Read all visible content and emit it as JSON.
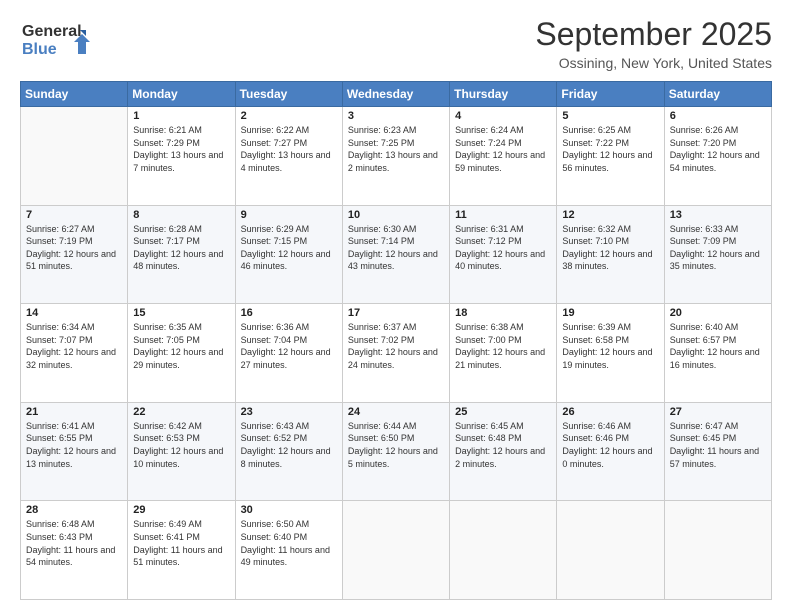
{
  "header": {
    "logo_general": "General",
    "logo_blue": "Blue",
    "month": "September 2025",
    "location": "Ossining, New York, United States"
  },
  "days_of_week": [
    "Sunday",
    "Monday",
    "Tuesday",
    "Wednesday",
    "Thursday",
    "Friday",
    "Saturday"
  ],
  "weeks": [
    [
      {
        "day": "",
        "sunrise": "",
        "sunset": "",
        "daylight": ""
      },
      {
        "day": "1",
        "sunrise": "Sunrise: 6:21 AM",
        "sunset": "Sunset: 7:29 PM",
        "daylight": "Daylight: 13 hours and 7 minutes."
      },
      {
        "day": "2",
        "sunrise": "Sunrise: 6:22 AM",
        "sunset": "Sunset: 7:27 PM",
        "daylight": "Daylight: 13 hours and 4 minutes."
      },
      {
        "day": "3",
        "sunrise": "Sunrise: 6:23 AM",
        "sunset": "Sunset: 7:25 PM",
        "daylight": "Daylight: 13 hours and 2 minutes."
      },
      {
        "day": "4",
        "sunrise": "Sunrise: 6:24 AM",
        "sunset": "Sunset: 7:24 PM",
        "daylight": "Daylight: 12 hours and 59 minutes."
      },
      {
        "day": "5",
        "sunrise": "Sunrise: 6:25 AM",
        "sunset": "Sunset: 7:22 PM",
        "daylight": "Daylight: 12 hours and 56 minutes."
      },
      {
        "day": "6",
        "sunrise": "Sunrise: 6:26 AM",
        "sunset": "Sunset: 7:20 PM",
        "daylight": "Daylight: 12 hours and 54 minutes."
      }
    ],
    [
      {
        "day": "7",
        "sunrise": "Sunrise: 6:27 AM",
        "sunset": "Sunset: 7:19 PM",
        "daylight": "Daylight: 12 hours and 51 minutes."
      },
      {
        "day": "8",
        "sunrise": "Sunrise: 6:28 AM",
        "sunset": "Sunset: 7:17 PM",
        "daylight": "Daylight: 12 hours and 48 minutes."
      },
      {
        "day": "9",
        "sunrise": "Sunrise: 6:29 AM",
        "sunset": "Sunset: 7:15 PM",
        "daylight": "Daylight: 12 hours and 46 minutes."
      },
      {
        "day": "10",
        "sunrise": "Sunrise: 6:30 AM",
        "sunset": "Sunset: 7:14 PM",
        "daylight": "Daylight: 12 hours and 43 minutes."
      },
      {
        "day": "11",
        "sunrise": "Sunrise: 6:31 AM",
        "sunset": "Sunset: 7:12 PM",
        "daylight": "Daylight: 12 hours and 40 minutes."
      },
      {
        "day": "12",
        "sunrise": "Sunrise: 6:32 AM",
        "sunset": "Sunset: 7:10 PM",
        "daylight": "Daylight: 12 hours and 38 minutes."
      },
      {
        "day": "13",
        "sunrise": "Sunrise: 6:33 AM",
        "sunset": "Sunset: 7:09 PM",
        "daylight": "Daylight: 12 hours and 35 minutes."
      }
    ],
    [
      {
        "day": "14",
        "sunrise": "Sunrise: 6:34 AM",
        "sunset": "Sunset: 7:07 PM",
        "daylight": "Daylight: 12 hours and 32 minutes."
      },
      {
        "day": "15",
        "sunrise": "Sunrise: 6:35 AM",
        "sunset": "Sunset: 7:05 PM",
        "daylight": "Daylight: 12 hours and 29 minutes."
      },
      {
        "day": "16",
        "sunrise": "Sunrise: 6:36 AM",
        "sunset": "Sunset: 7:04 PM",
        "daylight": "Daylight: 12 hours and 27 minutes."
      },
      {
        "day": "17",
        "sunrise": "Sunrise: 6:37 AM",
        "sunset": "Sunset: 7:02 PM",
        "daylight": "Daylight: 12 hours and 24 minutes."
      },
      {
        "day": "18",
        "sunrise": "Sunrise: 6:38 AM",
        "sunset": "Sunset: 7:00 PM",
        "daylight": "Daylight: 12 hours and 21 minutes."
      },
      {
        "day": "19",
        "sunrise": "Sunrise: 6:39 AM",
        "sunset": "Sunset: 6:58 PM",
        "daylight": "Daylight: 12 hours and 19 minutes."
      },
      {
        "day": "20",
        "sunrise": "Sunrise: 6:40 AM",
        "sunset": "Sunset: 6:57 PM",
        "daylight": "Daylight: 12 hours and 16 minutes."
      }
    ],
    [
      {
        "day": "21",
        "sunrise": "Sunrise: 6:41 AM",
        "sunset": "Sunset: 6:55 PM",
        "daylight": "Daylight: 12 hours and 13 minutes."
      },
      {
        "day": "22",
        "sunrise": "Sunrise: 6:42 AM",
        "sunset": "Sunset: 6:53 PM",
        "daylight": "Daylight: 12 hours and 10 minutes."
      },
      {
        "day": "23",
        "sunrise": "Sunrise: 6:43 AM",
        "sunset": "Sunset: 6:52 PM",
        "daylight": "Daylight: 12 hours and 8 minutes."
      },
      {
        "day": "24",
        "sunrise": "Sunrise: 6:44 AM",
        "sunset": "Sunset: 6:50 PM",
        "daylight": "Daylight: 12 hours and 5 minutes."
      },
      {
        "day": "25",
        "sunrise": "Sunrise: 6:45 AM",
        "sunset": "Sunset: 6:48 PM",
        "daylight": "Daylight: 12 hours and 2 minutes."
      },
      {
        "day": "26",
        "sunrise": "Sunrise: 6:46 AM",
        "sunset": "Sunset: 6:46 PM",
        "daylight": "Daylight: 12 hours and 0 minutes."
      },
      {
        "day": "27",
        "sunrise": "Sunrise: 6:47 AM",
        "sunset": "Sunset: 6:45 PM",
        "daylight": "Daylight: 11 hours and 57 minutes."
      }
    ],
    [
      {
        "day": "28",
        "sunrise": "Sunrise: 6:48 AM",
        "sunset": "Sunset: 6:43 PM",
        "daylight": "Daylight: 11 hours and 54 minutes."
      },
      {
        "day": "29",
        "sunrise": "Sunrise: 6:49 AM",
        "sunset": "Sunset: 6:41 PM",
        "daylight": "Daylight: 11 hours and 51 minutes."
      },
      {
        "day": "30",
        "sunrise": "Sunrise: 6:50 AM",
        "sunset": "Sunset: 6:40 PM",
        "daylight": "Daylight: 11 hours and 49 minutes."
      },
      {
        "day": "",
        "sunrise": "",
        "sunset": "",
        "daylight": ""
      },
      {
        "day": "",
        "sunrise": "",
        "sunset": "",
        "daylight": ""
      },
      {
        "day": "",
        "sunrise": "",
        "sunset": "",
        "daylight": ""
      },
      {
        "day": "",
        "sunrise": "",
        "sunset": "",
        "daylight": ""
      }
    ]
  ]
}
